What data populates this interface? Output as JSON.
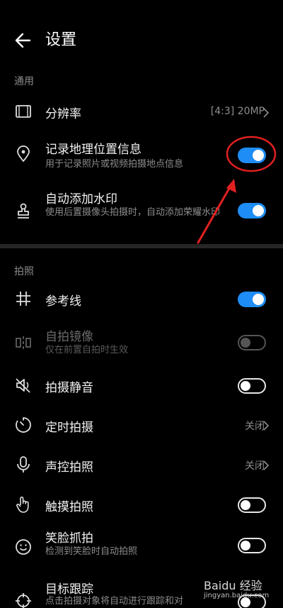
{
  "header": {
    "title": "设置",
    "back_icon": "arrow-left-icon"
  },
  "sections": {
    "general": "通用",
    "shooting": "拍照"
  },
  "general": {
    "resolution": {
      "label": "分辨率",
      "value": "[4:3] 20MP",
      "icon": "film-frame-icon"
    },
    "location": {
      "label": "记录地理位置信息",
      "sub": "用于记录照片或视频拍摄地点信息",
      "toggle": "on",
      "icon": "location-pin-icon"
    },
    "watermark": {
      "label": "自动添加水印",
      "sub": "使用后置摄像头拍摄时，自动添加荣耀水印",
      "toggle": "on",
      "icon": "stamp-icon"
    }
  },
  "shooting": {
    "grid": {
      "label": "参考线",
      "toggle": "on",
      "icon": "grid-hash-icon"
    },
    "mirror": {
      "label": "自拍镜像",
      "sub": "仅在前置自拍时生效",
      "toggle": "off",
      "disabled": true,
      "icon": "mirror-icon"
    },
    "mute": {
      "label": "拍摄静音",
      "toggle": "off",
      "icon": "speaker-muted-icon"
    },
    "timer": {
      "label": "定时拍摄",
      "value": "关闭",
      "icon": "timer-icon"
    },
    "voice": {
      "label": "声控拍照",
      "value": "关闭",
      "icon": "microphone-icon"
    },
    "touch": {
      "label": "触摸拍照",
      "toggle": "off",
      "icon": "touch-hand-icon"
    },
    "smile": {
      "label": "笑脸抓拍",
      "sub": "检测到笑脸时自动拍照",
      "toggle": "off",
      "icon": "smile-icon"
    },
    "tracking": {
      "label": "目标跟踪",
      "sub": "点击拍摄对象将自动进行跟踪和对",
      "toggle": "off",
      "icon": "crosshair-icon"
    }
  },
  "colors": {
    "accent": "#1e8df5",
    "annotation": "#e02020",
    "background": "#000000"
  },
  "watermark": {
    "main": "Baidu 经验",
    "sub": "jingyan.baidu.com"
  }
}
